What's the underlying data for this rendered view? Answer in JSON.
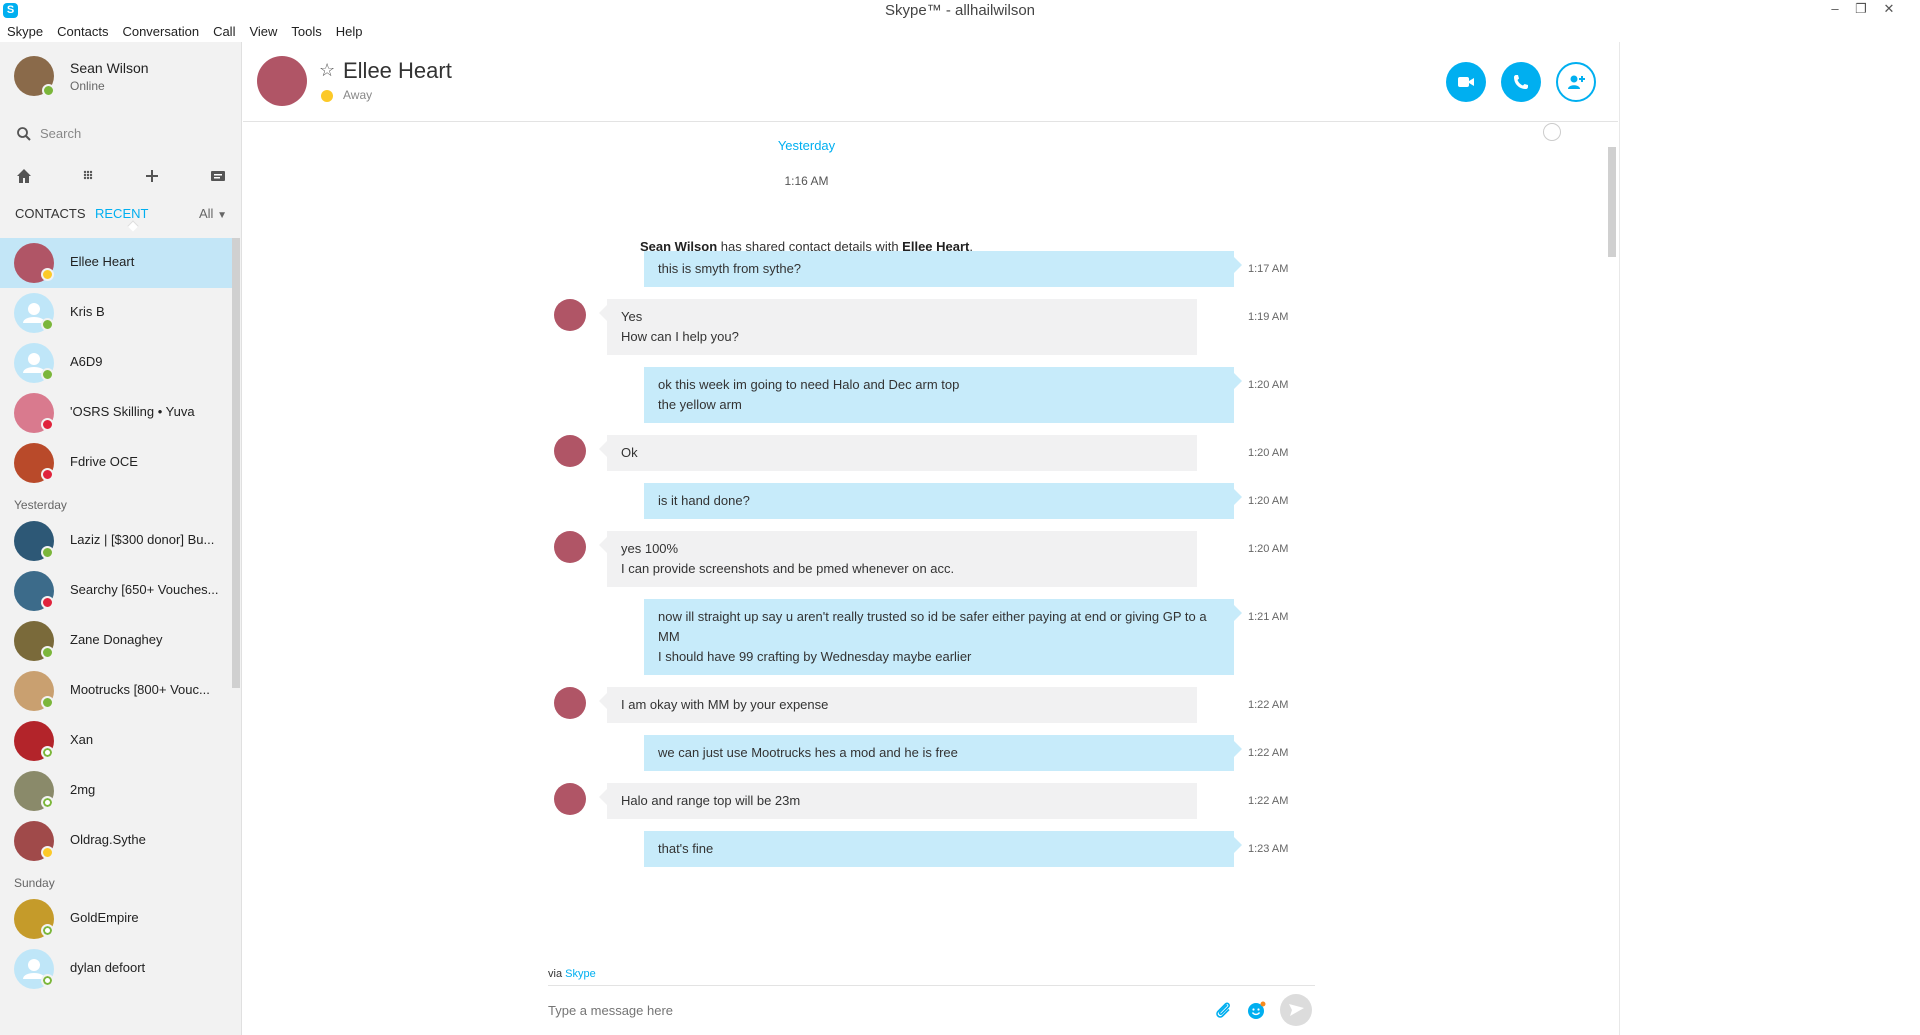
{
  "window": {
    "title": "Skype™ - allhailwilson"
  },
  "menu": [
    "Skype",
    "Contacts",
    "Conversation",
    "Call",
    "View",
    "Tools",
    "Help"
  ],
  "me": {
    "name": "Sean Wilson",
    "status": "Online"
  },
  "search": {
    "placeholder": "Search"
  },
  "tabs": {
    "contacts": "CONTACTS",
    "recent": "RECENT",
    "filter": "All"
  },
  "sidebar": {
    "groups": [
      {
        "header": "",
        "items": [
          {
            "name": "Ellee Heart",
            "status": "away",
            "color": "#b05566",
            "active": true
          },
          {
            "name": "Kris B",
            "status": "online",
            "color": "#bfe6f8",
            "default": true
          },
          {
            "name": "A6D9",
            "status": "online",
            "color": "#bfe6f8",
            "default": true
          },
          {
            "name": "'OSRS Skilling • Yuva",
            "status": "dnd",
            "color": "#d97a8e"
          },
          {
            "name": "Fdrive OCE",
            "status": "dnd",
            "color": "#b94a2a"
          }
        ]
      },
      {
        "header": "Yesterday",
        "items": [
          {
            "name": "Laziz | [$300 donor] Bu...",
            "status": "online",
            "color": "#2d5876"
          },
          {
            "name": "Searchy [650+ Vouches...",
            "status": "dnd",
            "color": "#3c6b8a"
          },
          {
            "name": "Zane Donaghey",
            "status": "online",
            "color": "#7a6a3a"
          },
          {
            "name": "Mootrucks [800+ Vouc...",
            "status": "online",
            "color": "#c9a070"
          },
          {
            "name": "Xan",
            "status": "offline",
            "color": "#b3242a"
          },
          {
            "name": "2mg",
            "status": "offline",
            "color": "#8a8a6a"
          },
          {
            "name": "Oldrag.Sythe",
            "status": "away",
            "color": "#a04a4a"
          }
        ]
      },
      {
        "header": "Sunday",
        "items": [
          {
            "name": "GoldEmpire",
            "status": "offline",
            "color": "#c59b2a"
          },
          {
            "name": "dylan defoort",
            "status": "offline",
            "color": "#bfe6f8",
            "default": true
          }
        ]
      }
    ]
  },
  "chat": {
    "contact_name": "Ellee Heart",
    "contact_status": "Away",
    "day_label": "Yesterday",
    "day_time": "1:16 AM",
    "system": {
      "sender": "Sean Wilson",
      "middle": " has shared contact details with ",
      "recipient": "Ellee Heart",
      "end": ".",
      "time": "1:17 AM"
    },
    "messages": [
      {
        "dir": "out",
        "lines": [
          "this is smyth from sythe?"
        ],
        "time": "1:17 AM"
      },
      {
        "dir": "in",
        "lines": [
          "Yes",
          "How can I help you?"
        ],
        "time": "1:19 AM"
      },
      {
        "dir": "out",
        "lines": [
          "ok this week im going to need Halo and Dec arm top",
          "the yellow arm"
        ],
        "time": "1:20 AM"
      },
      {
        "dir": "in",
        "lines": [
          "Ok"
        ],
        "time": "1:20 AM"
      },
      {
        "dir": "out",
        "lines": [
          "is it hand done?"
        ],
        "time": "1:20 AM"
      },
      {
        "dir": "in",
        "lines": [
          "yes 100%",
          "I can provide screenshots and be pmed whenever on acc."
        ],
        "time": "1:20 AM"
      },
      {
        "dir": "out",
        "lines": [
          "now ill straight up say u aren't really trusted so id be safer either paying at end or giving GP to a MM",
          "I should have 99 crafting by Wednesday maybe earlier"
        ],
        "time": "1:21 AM"
      },
      {
        "dir": "in",
        "lines": [
          "I am okay with MM by your expense"
        ],
        "time": "1:22 AM"
      },
      {
        "dir": "out",
        "lines": [
          "we can just use Mootrucks hes a mod and he is free"
        ],
        "time": "1:22 AM"
      },
      {
        "dir": "in",
        "lines": [
          "Halo and range top will be 23m"
        ],
        "time": "1:22 AM"
      },
      {
        "dir": "out",
        "lines": [
          "that's fine"
        ],
        "time": "1:23 AM"
      }
    ]
  },
  "composer": {
    "via_prefix": "via ",
    "via_link": "Skype",
    "placeholder": "Type a message here"
  },
  "colors": {
    "accent": "#00aff0",
    "outgoing_bubble": "#c7ebfa",
    "incoming_bubble": "#f1f1f2",
    "active_row": "#c3e6f7"
  }
}
